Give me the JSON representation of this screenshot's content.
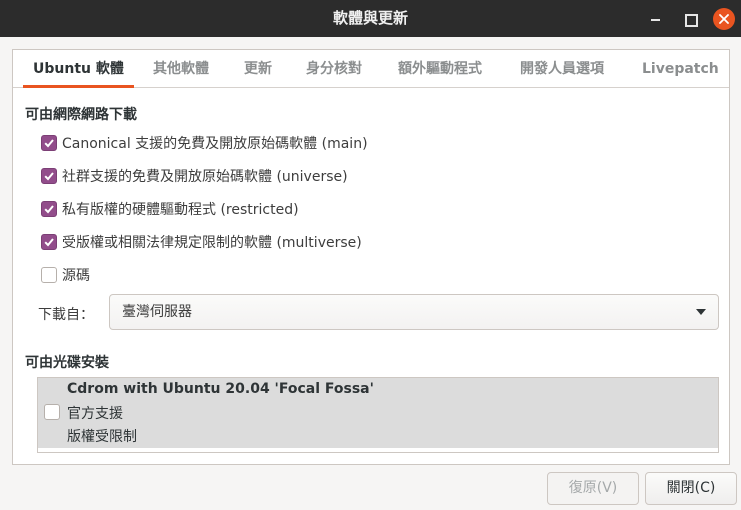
{
  "window": {
    "title": "軟體與更新"
  },
  "tabs": [
    {
      "label": "Ubuntu 軟體"
    },
    {
      "label": "其他軟體"
    },
    {
      "label": "更新"
    },
    {
      "label": "身分核對"
    },
    {
      "label": "額外驅動程式"
    },
    {
      "label": "開發人員選項"
    },
    {
      "label": "Livepatch"
    }
  ],
  "internet": {
    "heading": "可由網際網路下載",
    "options": [
      {
        "label": "Canonical 支援的免費及開放原始碼軟體 (main)",
        "checked": true
      },
      {
        "label": "社群支援的免費及開放原始碼軟體 (universe)",
        "checked": true
      },
      {
        "label": "私有版權的硬體驅動程式 (restricted)",
        "checked": true
      },
      {
        "label": "受版權或相關法律規定限制的軟體 (multiverse)",
        "checked": true
      },
      {
        "label": "源碼",
        "checked": false
      }
    ],
    "download_from_label": "下載自：",
    "download_server": "臺灣伺服器"
  },
  "cdrom": {
    "heading": "可由光碟安裝",
    "item": {
      "name": "Cdrom with Ubuntu 20.04 'Focal Fossa'",
      "line2": "官方支援",
      "line3": "版權受限制",
      "checked": false
    }
  },
  "buttons": {
    "revert": "復原(V)",
    "close": "關閉(C)"
  }
}
